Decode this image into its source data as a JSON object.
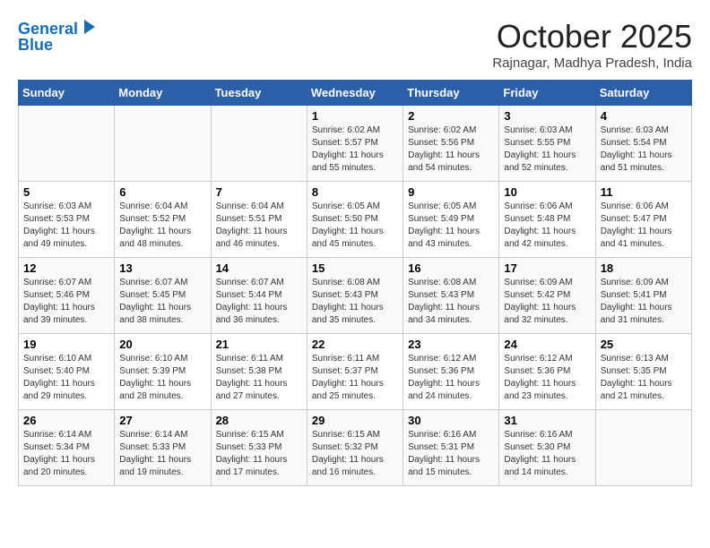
{
  "header": {
    "logo_line1": "General",
    "logo_line2": "Blue",
    "month": "October 2025",
    "location": "Rajnagar, Madhya Pradesh, India"
  },
  "days_of_week": [
    "Sunday",
    "Monday",
    "Tuesday",
    "Wednesday",
    "Thursday",
    "Friday",
    "Saturday"
  ],
  "weeks": [
    [
      {
        "day": "",
        "info": ""
      },
      {
        "day": "",
        "info": ""
      },
      {
        "day": "",
        "info": ""
      },
      {
        "day": "1",
        "info": "Sunrise: 6:02 AM\nSunset: 5:57 PM\nDaylight: 11 hours\nand 55 minutes."
      },
      {
        "day": "2",
        "info": "Sunrise: 6:02 AM\nSunset: 5:56 PM\nDaylight: 11 hours\nand 54 minutes."
      },
      {
        "day": "3",
        "info": "Sunrise: 6:03 AM\nSunset: 5:55 PM\nDaylight: 11 hours\nand 52 minutes."
      },
      {
        "day": "4",
        "info": "Sunrise: 6:03 AM\nSunset: 5:54 PM\nDaylight: 11 hours\nand 51 minutes."
      }
    ],
    [
      {
        "day": "5",
        "info": "Sunrise: 6:03 AM\nSunset: 5:53 PM\nDaylight: 11 hours\nand 49 minutes."
      },
      {
        "day": "6",
        "info": "Sunrise: 6:04 AM\nSunset: 5:52 PM\nDaylight: 11 hours\nand 48 minutes."
      },
      {
        "day": "7",
        "info": "Sunrise: 6:04 AM\nSunset: 5:51 PM\nDaylight: 11 hours\nand 46 minutes."
      },
      {
        "day": "8",
        "info": "Sunrise: 6:05 AM\nSunset: 5:50 PM\nDaylight: 11 hours\nand 45 minutes."
      },
      {
        "day": "9",
        "info": "Sunrise: 6:05 AM\nSunset: 5:49 PM\nDaylight: 11 hours\nand 43 minutes."
      },
      {
        "day": "10",
        "info": "Sunrise: 6:06 AM\nSunset: 5:48 PM\nDaylight: 11 hours\nand 42 minutes."
      },
      {
        "day": "11",
        "info": "Sunrise: 6:06 AM\nSunset: 5:47 PM\nDaylight: 11 hours\nand 41 minutes."
      }
    ],
    [
      {
        "day": "12",
        "info": "Sunrise: 6:07 AM\nSunset: 5:46 PM\nDaylight: 11 hours\nand 39 minutes."
      },
      {
        "day": "13",
        "info": "Sunrise: 6:07 AM\nSunset: 5:45 PM\nDaylight: 11 hours\nand 38 minutes."
      },
      {
        "day": "14",
        "info": "Sunrise: 6:07 AM\nSunset: 5:44 PM\nDaylight: 11 hours\nand 36 minutes."
      },
      {
        "day": "15",
        "info": "Sunrise: 6:08 AM\nSunset: 5:43 PM\nDaylight: 11 hours\nand 35 minutes."
      },
      {
        "day": "16",
        "info": "Sunrise: 6:08 AM\nSunset: 5:43 PM\nDaylight: 11 hours\nand 34 minutes."
      },
      {
        "day": "17",
        "info": "Sunrise: 6:09 AM\nSunset: 5:42 PM\nDaylight: 11 hours\nand 32 minutes."
      },
      {
        "day": "18",
        "info": "Sunrise: 6:09 AM\nSunset: 5:41 PM\nDaylight: 11 hours\nand 31 minutes."
      }
    ],
    [
      {
        "day": "19",
        "info": "Sunrise: 6:10 AM\nSunset: 5:40 PM\nDaylight: 11 hours\nand 29 minutes."
      },
      {
        "day": "20",
        "info": "Sunrise: 6:10 AM\nSunset: 5:39 PM\nDaylight: 11 hours\nand 28 minutes."
      },
      {
        "day": "21",
        "info": "Sunrise: 6:11 AM\nSunset: 5:38 PM\nDaylight: 11 hours\nand 27 minutes."
      },
      {
        "day": "22",
        "info": "Sunrise: 6:11 AM\nSunset: 5:37 PM\nDaylight: 11 hours\nand 25 minutes."
      },
      {
        "day": "23",
        "info": "Sunrise: 6:12 AM\nSunset: 5:36 PM\nDaylight: 11 hours\nand 24 minutes."
      },
      {
        "day": "24",
        "info": "Sunrise: 6:12 AM\nSunset: 5:36 PM\nDaylight: 11 hours\nand 23 minutes."
      },
      {
        "day": "25",
        "info": "Sunrise: 6:13 AM\nSunset: 5:35 PM\nDaylight: 11 hours\nand 21 minutes."
      }
    ],
    [
      {
        "day": "26",
        "info": "Sunrise: 6:14 AM\nSunset: 5:34 PM\nDaylight: 11 hours\nand 20 minutes."
      },
      {
        "day": "27",
        "info": "Sunrise: 6:14 AM\nSunset: 5:33 PM\nDaylight: 11 hours\nand 19 minutes."
      },
      {
        "day": "28",
        "info": "Sunrise: 6:15 AM\nSunset: 5:33 PM\nDaylight: 11 hours\nand 17 minutes."
      },
      {
        "day": "29",
        "info": "Sunrise: 6:15 AM\nSunset: 5:32 PM\nDaylight: 11 hours\nand 16 minutes."
      },
      {
        "day": "30",
        "info": "Sunrise: 6:16 AM\nSunset: 5:31 PM\nDaylight: 11 hours\nand 15 minutes."
      },
      {
        "day": "31",
        "info": "Sunrise: 6:16 AM\nSunset: 5:30 PM\nDaylight: 11 hours\nand 14 minutes."
      },
      {
        "day": "",
        "info": ""
      }
    ]
  ]
}
